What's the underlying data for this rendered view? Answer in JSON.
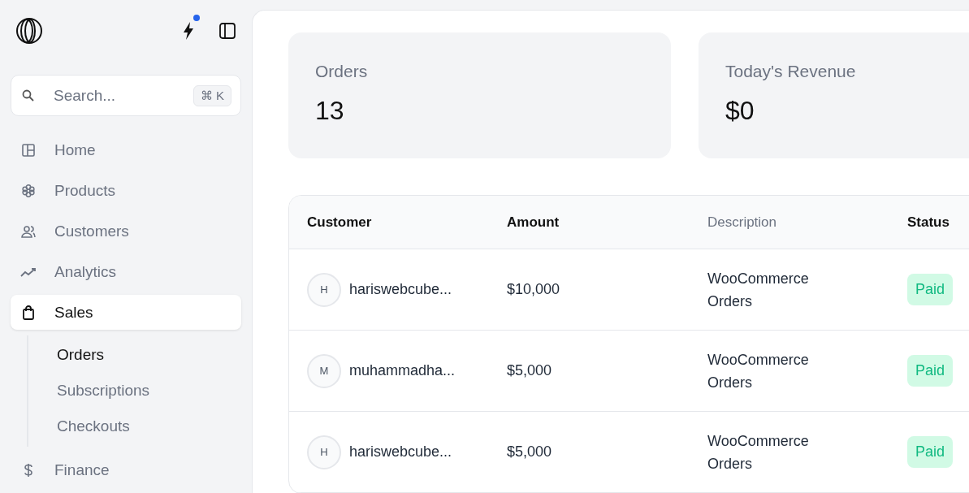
{
  "sidebar": {
    "notification_dot": true,
    "search": {
      "placeholder": "Search...",
      "shortcut": "⌘ K"
    },
    "items": [
      {
        "label": "Home",
        "selected": false
      },
      {
        "label": "Products",
        "selected": false
      },
      {
        "label": "Customers",
        "selected": false
      },
      {
        "label": "Analytics",
        "selected": false
      },
      {
        "label": "Sales",
        "selected": true,
        "children": [
          {
            "label": "Orders",
            "selected": true
          },
          {
            "label": "Subscriptions",
            "selected": false
          },
          {
            "label": "Checkouts",
            "selected": false
          }
        ]
      },
      {
        "label": "Finance",
        "selected": false
      }
    ]
  },
  "stats": [
    {
      "label": "Orders",
      "value": "13"
    },
    {
      "label": "Today's Revenue",
      "value": "$0"
    }
  ],
  "table": {
    "columns": [
      "Customer",
      "Amount",
      "Description",
      "Status"
    ],
    "rows": [
      {
        "initial": "H",
        "customer": "hariswebcube...",
        "amount": "$10,000",
        "description": "WooCommerce Orders",
        "status": "Paid"
      },
      {
        "initial": "M",
        "customer": "muhammadha...",
        "amount": "$5,000",
        "description": "WooCommerce Orders",
        "status": "Paid"
      },
      {
        "initial": "H",
        "customer": "hariswebcube...",
        "amount": "$5,000",
        "description": "WooCommerce Orders",
        "status": "Paid"
      }
    ]
  }
}
